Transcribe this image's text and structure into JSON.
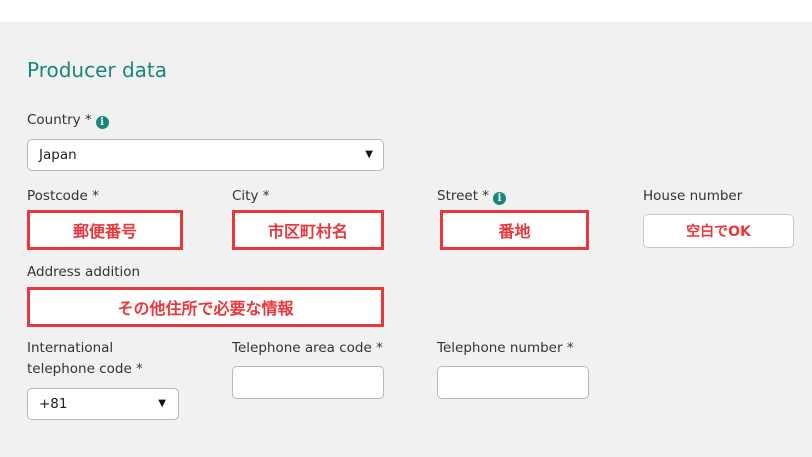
{
  "section": {
    "title": "Producer data"
  },
  "country": {
    "label": "Country *",
    "info_icon": "info-icon",
    "value": "Japan"
  },
  "postcode": {
    "label": "Postcode *",
    "annotation": "郵便番号"
  },
  "city": {
    "label": "City *",
    "annotation": "市区町村名"
  },
  "street": {
    "label": "Street *",
    "info_icon": "info-icon",
    "annotation": "番地"
  },
  "house_number": {
    "label": "House number",
    "annotation": "空白でOK"
  },
  "address_addition": {
    "label": "Address addition",
    "annotation": "その他住所で必要な情報"
  },
  "intl_code": {
    "label_line1": "International",
    "label_line2": "telephone code *",
    "value": "+81"
  },
  "area_code": {
    "label": "Telephone area code *",
    "value": ""
  },
  "phone_number": {
    "label": "Telephone number *",
    "value": ""
  },
  "colors": {
    "accent": "#17877a",
    "annotation_red": "#e8383d",
    "panel_bg": "#f1f1f1"
  }
}
